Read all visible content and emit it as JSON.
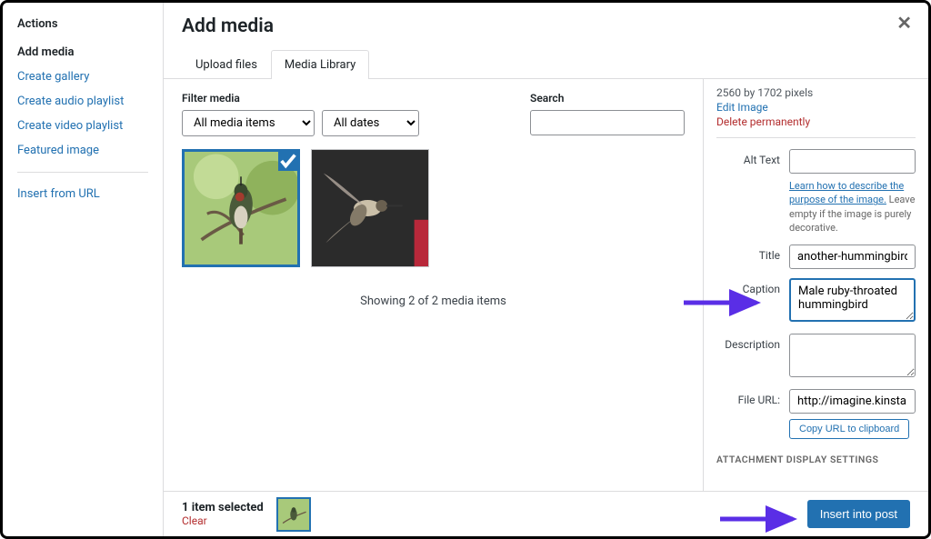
{
  "sidebar": {
    "title": "Actions",
    "items": [
      {
        "label": "Add media",
        "active": true
      },
      {
        "label": "Create gallery"
      },
      {
        "label": "Create audio playlist"
      },
      {
        "label": "Create video playlist"
      },
      {
        "label": "Featured image"
      }
    ],
    "insert_url": "Insert from URL"
  },
  "header": {
    "title": "Add media"
  },
  "tabs": {
    "upload": "Upload files",
    "library": "Media Library"
  },
  "filter": {
    "heading": "Filter media",
    "all_items": "All media items",
    "all_dates": "All dates"
  },
  "search": {
    "heading": "Search",
    "value": ""
  },
  "thumbs": {
    "showing": "Showing 2 of 2 media items"
  },
  "details": {
    "dimensions": "2560 by 1702 pixels",
    "edit_image": "Edit Image",
    "delete": "Delete permanently",
    "alt_label": "Alt Text",
    "alt_value": "",
    "alt_help_link": "Learn how to describe the purpose of the image.",
    "alt_help_rest": " Leave empty if the image is purely decorative.",
    "title_label": "Title",
    "title_value": "another-hummingbird",
    "caption_label": "Caption",
    "caption_value": "Male ruby-throated hummingbird",
    "description_label": "Description",
    "description_value": "",
    "fileurl_label": "File URL:",
    "fileurl_value": "http://imagine.kinsta.cloud",
    "copy_btn": "Copy URL to clipboard",
    "display_settings": "ATTACHMENT DISPLAY SETTINGS"
  },
  "footer": {
    "selected": "1 item selected",
    "clear": "Clear",
    "insert": "Insert into post"
  }
}
